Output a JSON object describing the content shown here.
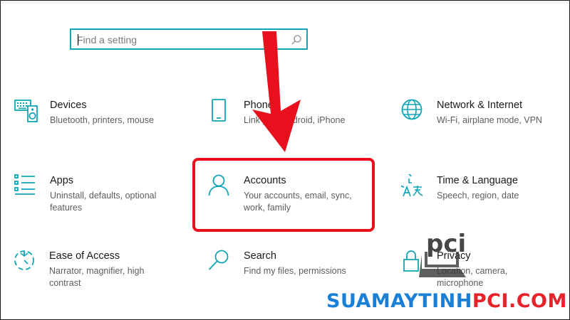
{
  "search": {
    "placeholder": "Find a setting",
    "icon": "search-icon"
  },
  "tiles": [
    {
      "title": "Devices",
      "desc": "Bluetooth, printers, mouse",
      "icon": "keyboard-speaker-icon"
    },
    {
      "title": "Phone",
      "desc": "Link your Android, iPhone",
      "icon": "phone-icon"
    },
    {
      "title": "Network & Internet",
      "desc": "Wi-Fi, airplane mode, VPN",
      "icon": "globe-icon"
    },
    {
      "title": "Apps",
      "desc": "Uninstall, defaults, optional features",
      "icon": "apps-list-icon"
    },
    {
      "title": "Accounts",
      "desc": "Your accounts, email, sync, work, family",
      "icon": "person-icon"
    },
    {
      "title": "Time & Language",
      "desc": "Speech, region, date",
      "icon": "time-language-icon"
    },
    {
      "title": "Ease of Access",
      "desc": "Narrator, magnifier, high contrast",
      "icon": "ease-of-access-icon"
    },
    {
      "title": "Search",
      "desc": "Find my files, permissions",
      "icon": "search-icon"
    },
    {
      "title": "Privacy",
      "desc": "Location, camera, microphone",
      "icon": "lock-icon"
    }
  ],
  "annotation": {
    "highlight_color": "#e8101c",
    "arrow_color": "#e8101c"
  },
  "watermark": {
    "logo_text": "pci",
    "site_part1": "SUAMAYTINH",
    "site_part2": "PCI.COM"
  },
  "colors": {
    "accent": "#0fa5b8",
    "text": "#1a1a1a",
    "subtext": "#5d5d5d"
  }
}
